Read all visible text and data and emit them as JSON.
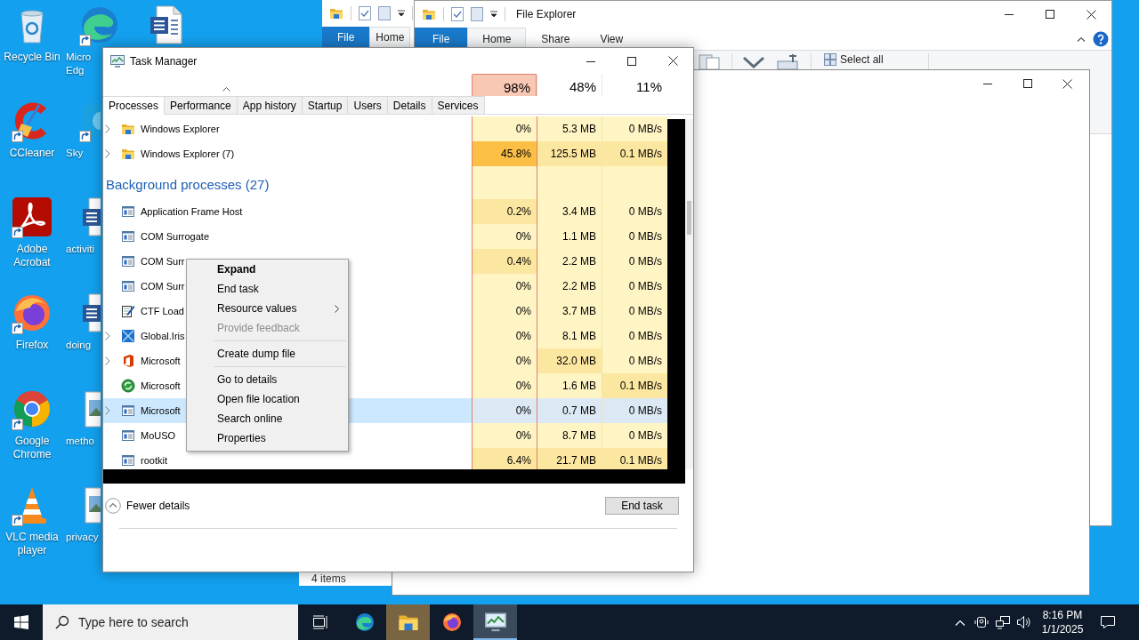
{
  "desktop": {
    "icons": [
      {
        "kind": "recycle-bin",
        "label": [
          "Recycle Bin"
        ],
        "shortcut": false
      },
      {
        "kind": "cleaner",
        "label": [
          "CCleaner"
        ],
        "shortcut": true
      },
      {
        "kind": "pdf",
        "label": [
          "Adobe",
          "Acrobat"
        ],
        "shortcut": true
      },
      {
        "kind": "firefox",
        "label": [
          "Firefox"
        ],
        "shortcut": true
      },
      {
        "kind": "chrome",
        "label": [
          "Google",
          "Chrome"
        ],
        "shortcut": true
      },
      {
        "kind": "cone",
        "label": [
          "VLC media",
          "player"
        ],
        "shortcut": true
      },
      {
        "kind": "edge",
        "label": [
          "Micro",
          "Edg"
        ],
        "shortcut": true
      },
      {
        "kind": "chat",
        "label": [
          "Sky"
        ],
        "shortcut": true
      },
      {
        "kind": "document",
        "label": [
          "activiti"
        ],
        "shortcut": false
      },
      {
        "kind": "document",
        "label": [
          "doing"
        ],
        "shortcut": false
      },
      {
        "kind": "image",
        "label": [
          "metho"
        ],
        "shortcut": false
      },
      {
        "kind": "image",
        "label": [
          "privacy"
        ],
        "shortcut": false
      },
      {
        "kind": "document",
        "shortcut": false
      }
    ]
  },
  "explorer_back": {
    "tabs": [
      {
        "label": "File",
        "kind": "file",
        "selected": false
      },
      {
        "label": "Home",
        "kind": "tab",
        "selected": true
      }
    ]
  },
  "explorer_front": {
    "title": "File Explorer",
    "tabs": [
      {
        "label": "File",
        "kind": "file",
        "selected": false
      },
      {
        "label": "Home",
        "kind": "tab",
        "selected": true
      },
      {
        "label": "Share",
        "kind": "tab",
        "selected": false
      },
      {
        "label": "View",
        "kind": "tab",
        "selected": false
      }
    ],
    "select_all": "Select all"
  },
  "status_window": {
    "status": "4 items"
  },
  "task_manager": {
    "title": "Task Manager",
    "columns": [
      {
        "percent": "98%",
        "alert": true
      },
      {
        "percent": "48%",
        "alert": false
      },
      {
        "percent": "11%",
        "alert": false
      }
    ],
    "tabs": [
      {
        "label": "Processes",
        "selected": true
      },
      {
        "label": "Performance",
        "selected": false
      },
      {
        "label": "App history",
        "selected": false
      },
      {
        "label": "Startup",
        "selected": false
      },
      {
        "label": "Users",
        "selected": false
      },
      {
        "label": "Details",
        "selected": false
      },
      {
        "label": "Services",
        "selected": false
      }
    ],
    "rows": [
      {
        "kind": "folder",
        "name": "Windows Explorer",
        "expandable": true,
        "selected": false,
        "cells": [
          {
            "text": "0%",
            "color": "#fff4c4"
          },
          {
            "text": "5.3 MB",
            "color": "#fff4c4"
          },
          {
            "text": "0 MB/s",
            "color": "#fff4c4"
          }
        ]
      },
      {
        "kind": "folder",
        "name": "Windows Explorer (7)",
        "expandable": true,
        "selected": false,
        "cells": [
          {
            "text": "45.8%",
            "color": "#fcbf45"
          },
          {
            "text": "125.5 MB",
            "color": "#fce7a0"
          },
          {
            "text": "0.1 MB/s",
            "color": "#fce7a0"
          }
        ]
      },
      {
        "kind": "group",
        "name": "Background processes (27)",
        "expandable": false,
        "selected": false,
        "cells": [
          {
            "color": "#fff4c4"
          },
          {
            "color": "#fff4c4"
          },
          {
            "color": "#fff4c4"
          }
        ]
      },
      {
        "kind": "window",
        "name": "Application Frame Host",
        "expandable": false,
        "selected": false,
        "cells": [
          {
            "text": "0.2%",
            "color": "#fce7a0"
          },
          {
            "text": "3.4 MB",
            "color": "#fff4c4"
          },
          {
            "text": "0 MB/s",
            "color": "#fff4c4"
          }
        ]
      },
      {
        "kind": "window",
        "name": "COM Surrogate",
        "expandable": false,
        "selected": false,
        "cells": [
          {
            "text": "0%",
            "color": "#fff4c4"
          },
          {
            "text": "1.1 MB",
            "color": "#fff4c4"
          },
          {
            "text": "0 MB/s",
            "color": "#fff4c4"
          }
        ]
      },
      {
        "kind": "window",
        "name": "COM Surr",
        "expandable": false,
        "selected": false,
        "cells": [
          {
            "text": "0.4%",
            "color": "#fce7a0"
          },
          {
            "text": "2.2 MB",
            "color": "#fff4c4"
          },
          {
            "text": "0 MB/s",
            "color": "#fff4c4"
          }
        ]
      },
      {
        "kind": "window",
        "name": "COM Surr",
        "expandable": false,
        "selected": false,
        "cells": [
          {
            "text": "0%",
            "color": "#fff4c4"
          },
          {
            "text": "2.2 MB",
            "color": "#fff4c4"
          },
          {
            "text": "0 MB/s",
            "color": "#fff4c4"
          }
        ]
      },
      {
        "kind": "notepad",
        "name": "CTF Load",
        "expandable": false,
        "selected": false,
        "cells": [
          {
            "text": "0%",
            "color": "#fff4c4"
          },
          {
            "text": "3.7 MB",
            "color": "#fff4c4"
          },
          {
            "text": "0 MB/s",
            "color": "#fff4c4"
          }
        ]
      },
      {
        "kind": "cross-box",
        "name": "Global.Iris",
        "expandable": true,
        "selected": false,
        "cells": [
          {
            "text": "0%",
            "color": "#fff4c4"
          },
          {
            "text": "8.1 MB",
            "color": "#fff4c4"
          },
          {
            "text": "0 MB/s",
            "color": "#fff4c4"
          }
        ]
      },
      {
        "kind": "office",
        "name": "Microsoft",
        "expandable": true,
        "selected": false,
        "cells": [
          {
            "text": "0%",
            "color": "#fff4c4"
          },
          {
            "text": "32.0 MB",
            "color": "#fce7a0"
          },
          {
            "text": "0 MB/s",
            "color": "#fff4c4"
          }
        ]
      },
      {
        "kind": "circle",
        "name": "Microsoft",
        "expandable": false,
        "selected": false,
        "cells": [
          {
            "text": "0%",
            "color": "#fff4c4"
          },
          {
            "text": "1.6 MB",
            "color": "#fff4c4"
          },
          {
            "text": "0.1 MB/s",
            "color": "#fce7a0"
          }
        ]
      },
      {
        "kind": "window",
        "name": "Microsoft",
        "expandable": true,
        "selected": true,
        "cells": [
          {
            "text": "0%",
            "color": "#dce9f4"
          },
          {
            "text": "0.7 MB",
            "color": "#dce9f4"
          },
          {
            "text": "0 MB/s",
            "color": "#dce9f4"
          }
        ]
      },
      {
        "kind": "window",
        "name": "MoUSO",
        "expandable": false,
        "selected": false,
        "cells": [
          {
            "text": "0%",
            "color": "#fff4c4"
          },
          {
            "text": "8.7 MB",
            "color": "#fff4c4"
          },
          {
            "text": "0 MB/s",
            "color": "#fff4c4"
          }
        ]
      },
      {
        "kind": "window",
        "name": "rootkit",
        "expandable": false,
        "selected": false,
        "cells": [
          {
            "text": "6.4%",
            "color": "#fce7a0"
          },
          {
            "text": "21.7 MB",
            "color": "#fce7a0"
          },
          {
            "text": "0.1 MB/s",
            "color": "#fce7a0"
          }
        ]
      }
    ],
    "fewer_details": "Fewer details",
    "end_task": "End task"
  },
  "context_menu": {
    "items": [
      {
        "kind": "item",
        "label": "Expand",
        "default": true,
        "disabled": false,
        "submenu": false
      },
      {
        "kind": "item",
        "label": "End task",
        "default": false,
        "disabled": false,
        "submenu": false
      },
      {
        "kind": "item",
        "label": "Resource values",
        "default": false,
        "disabled": false,
        "submenu": true
      },
      {
        "kind": "item",
        "label": "Provide feedback",
        "default": false,
        "disabled": true,
        "submenu": false
      },
      {
        "kind": "separator"
      },
      {
        "kind": "item",
        "label": "Create dump file",
        "default": false,
        "disabled": false,
        "submenu": false
      },
      {
        "kind": "separator"
      },
      {
        "kind": "item",
        "label": "Go to details",
        "default": false,
        "disabled": false,
        "submenu": false
      },
      {
        "kind": "item",
        "label": "Open file location",
        "default": false,
        "disabled": false,
        "submenu": false
      },
      {
        "kind": "item",
        "label": "Search online",
        "default": false,
        "disabled": false,
        "submenu": false
      },
      {
        "kind": "item",
        "label": "Properties",
        "default": false,
        "disabled": false,
        "submenu": false
      }
    ]
  },
  "taskbar": {
    "search": {
      "placeholder": "Type here to search"
    },
    "apps": [
      {
        "kind": "edge",
        "active": false,
        "flashing": false
      },
      {
        "kind": "folder",
        "active": false,
        "flashing": true
      },
      {
        "kind": "firefox",
        "active": false,
        "flashing": false
      },
      {
        "kind": "task-manager",
        "active": true,
        "flashing": false
      }
    ],
    "clock": {
      "time": "8:16 PM",
      "date": "1/1/2025"
    }
  }
}
